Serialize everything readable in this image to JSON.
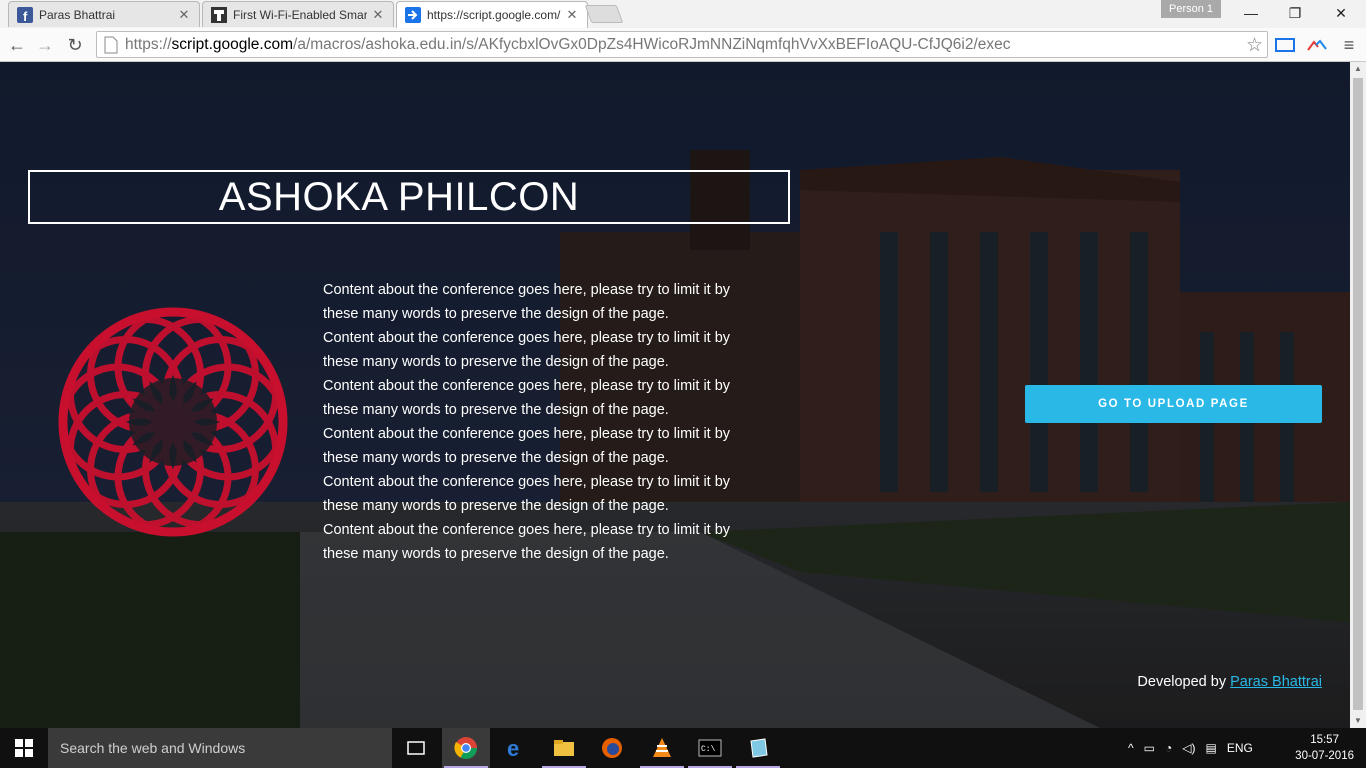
{
  "browser": {
    "tabs": [
      {
        "label": "Paras Bhattrai",
        "icon": "facebook-icon",
        "active": false
      },
      {
        "label": "First Wi-Fi-Enabled Smart",
        "icon": "instructables-icon",
        "active": false
      },
      {
        "label": "https://script.google.com/",
        "icon": "apps-script-icon",
        "active": true
      }
    ],
    "person_label": "Person 1",
    "url": {
      "scheme": "https://",
      "host": "script.google.com",
      "path": "/a/macros/ashoka.edu.in/s/AKfycbxlOvGx0DpZs4HWicoRJmNNZiNqmfqhVvXxBEFIoAQU-CfJQ6i2/exec"
    }
  },
  "page": {
    "title": "ASHOKA PHILCON",
    "content_paragraphs": [
      "Content about the conference goes here, please try to limit it by these many words to preserve the design of the page.",
      "Content about the conference goes here, please try to limit it by these many words to preserve the design of the page.",
      "Content about the conference goes here, please try to limit it by these many words to preserve the design of the page.",
      "Content about the conference goes here, please try to limit it by these many words to preserve the design of the page.",
      "Content about the conference goes here, please try to limit it by these many words to preserve the design of the page.",
      "Content about the conference goes here, please try to limit it by these many words to preserve the design of the page."
    ],
    "upload_button": "GO TO UPLOAD PAGE",
    "footer_prefix": "Developed by",
    "footer_link": "Paras Bhattrai",
    "logo_color": "#c8102e",
    "accent_color": "#2ab8e7"
  },
  "taskbar": {
    "search_placeholder": "Search the web and Windows",
    "language": "ENG",
    "time": "15:57",
    "date": "30-07-2016"
  }
}
